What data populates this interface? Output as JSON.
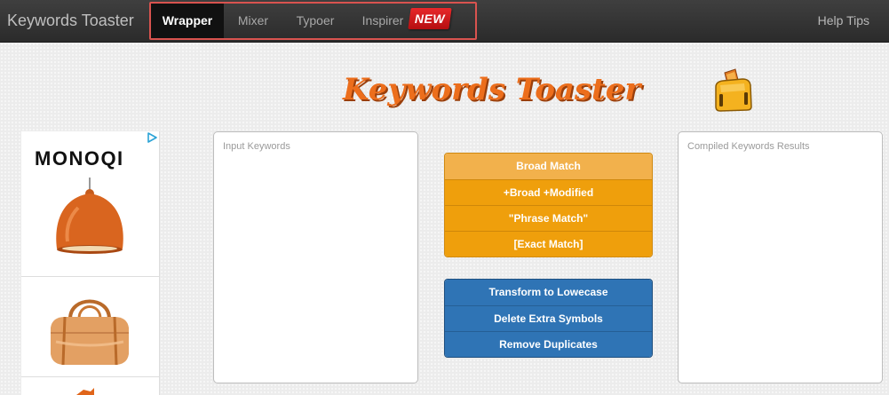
{
  "navbar": {
    "brand": "Keywords Toaster",
    "tabs": [
      {
        "label": "Wrapper",
        "active": true
      },
      {
        "label": "Mixer",
        "active": false
      },
      {
        "label": "Typoer",
        "active": false
      },
      {
        "label": "Inspirer",
        "active": false
      }
    ],
    "new_badge": "NEW",
    "help": "Help Tips"
  },
  "logo": {
    "title": "Keywords Toaster"
  },
  "ad": {
    "brand": "MONOQI"
  },
  "input_panel": {
    "placeholder": "Input Keywords"
  },
  "results_panel": {
    "placeholder": "Compiled Keywords Results"
  },
  "match_buttons": [
    "Broad Match",
    "+Broad +Modified",
    "\"Phrase Match\"",
    "[Exact Match]"
  ],
  "tool_buttons": [
    "Transform to Lowecase",
    "Delete Extra Symbols",
    "Remove Duplicates"
  ],
  "colors": {
    "nav_bg": "#333333",
    "match_orange": "#ef9f0c",
    "tool_blue": "#2f74b5",
    "logo_orange": "#ec6e1c",
    "highlight_red": "#d9534f"
  }
}
